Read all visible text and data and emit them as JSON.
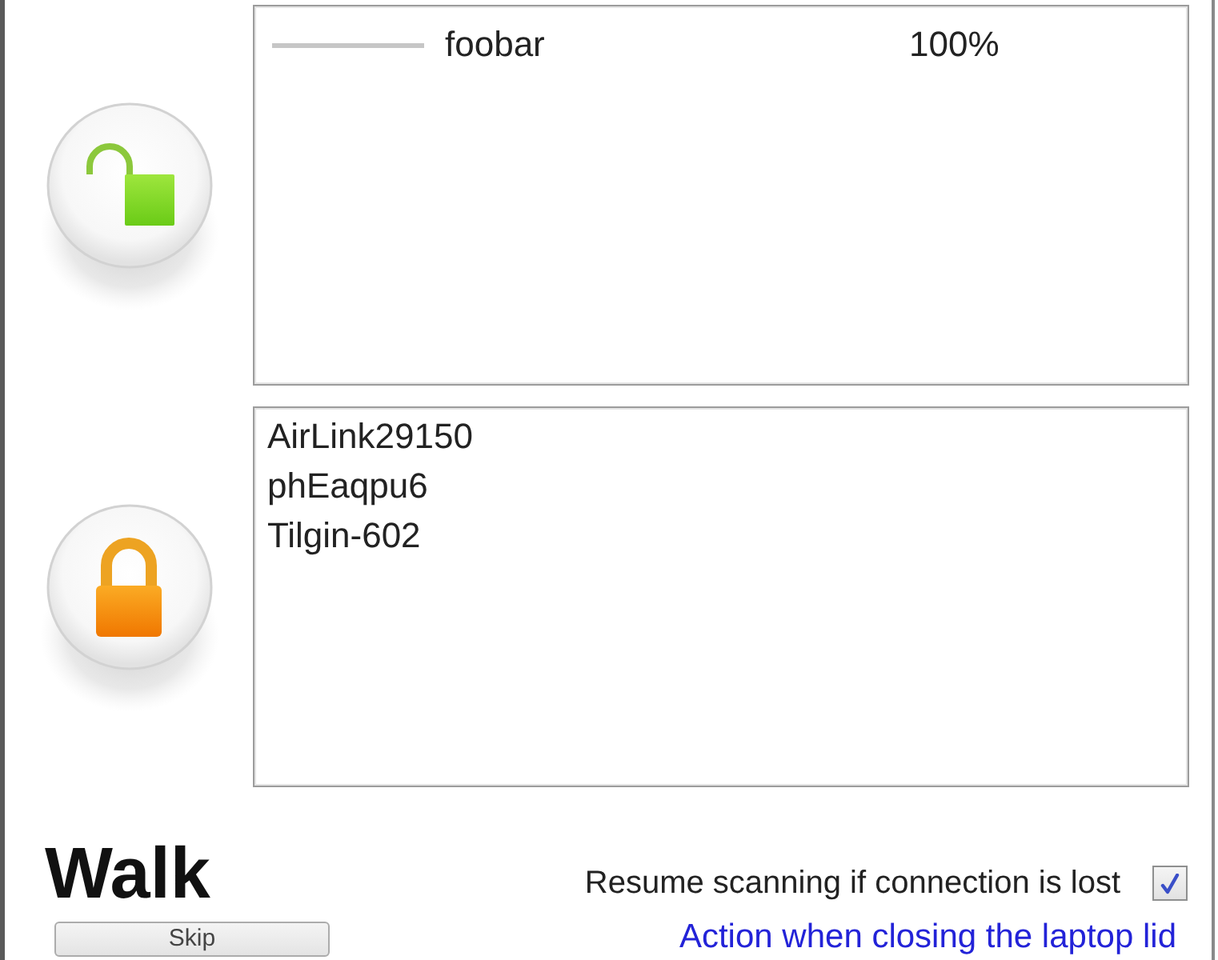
{
  "lists": [
    {
      "kind": "open",
      "networks": [
        {
          "name": "foobar",
          "level": 1,
          "signal": "100%"
        }
      ]
    },
    {
      "kind": "secured",
      "networks": [
        {
          "name": "AirLink29150"
        },
        {
          "name": "phEaqpu6"
        },
        {
          "name": "Tilgin-602"
        }
      ]
    }
  ],
  "mode": {
    "title": "Walk",
    "button": "Skip"
  },
  "resume_scanning": {
    "label": "Resume scanning if connection is lost",
    "checked": true
  },
  "lid_action_link": "Action when closing the laptop lid"
}
